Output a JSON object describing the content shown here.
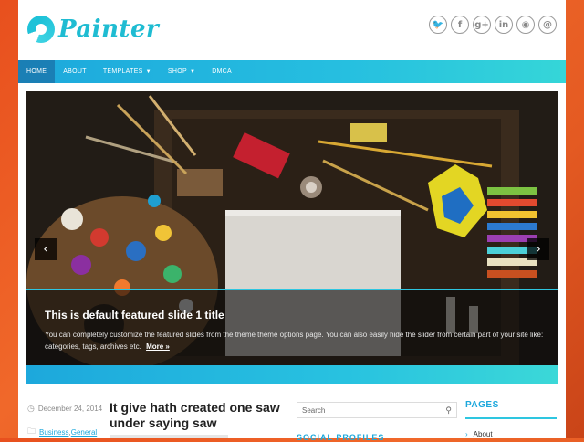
{
  "site": {
    "logo_text": "Painter"
  },
  "colors": {
    "accent": "#1da8dc",
    "accent_light": "#35d6d8",
    "nav_active": "#1a7fb5",
    "background": "#e8501e"
  },
  "social": [
    {
      "icon": "twitter-icon",
      "glyph": "🐦"
    },
    {
      "icon": "facebook-icon",
      "glyph": "f"
    },
    {
      "icon": "google-plus-icon",
      "glyph": "g+"
    },
    {
      "icon": "linkedin-icon",
      "glyph": "in"
    },
    {
      "icon": "rss-icon",
      "glyph": "◉"
    },
    {
      "icon": "email-icon",
      "glyph": "@"
    }
  ],
  "nav": {
    "home": "HOME",
    "about": "ABOUT",
    "templates": "TEMPLATES",
    "shop": "SHOP",
    "dmca": "DMCA",
    "caret": "▼"
  },
  "slider": {
    "title": "This is default featured slide 1 title",
    "text": "You can completely customize the featured slides from the theme theme options page. You can also easily hide the slider from certain part of your site like: categories, tags, archives etc.",
    "more": "More »",
    "prev": "‹",
    "next": "›"
  },
  "post": {
    "date": "December 24, 2014",
    "category_1": "Business",
    "separator": ",",
    "category_2": "General",
    "title": "It give hath created one saw under saying saw"
  },
  "sidebar": {
    "search_placeholder": "Search",
    "social_heading": "SOCIAL PROFILES",
    "pages_heading": "PAGES",
    "pages_items": [
      "About"
    ]
  }
}
